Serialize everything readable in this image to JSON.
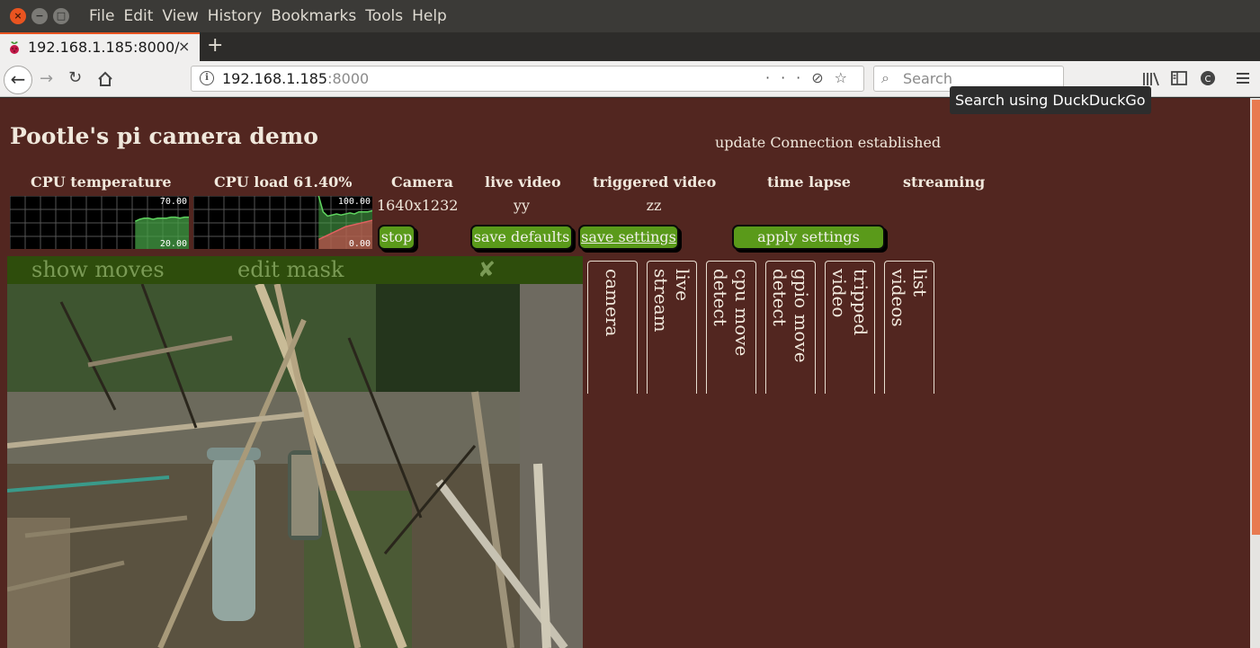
{
  "menubar": {
    "items": [
      "File",
      "Edit",
      "View",
      "History",
      "Bookmarks",
      "Tools",
      "Help"
    ]
  },
  "tab": {
    "title": "192.168.1.185:8000/",
    "close": "×",
    "new_tab": "+"
  },
  "urlbar": {
    "host": "192.168.1.185",
    "port": ":8000",
    "right_icons": "···⊘☆"
  },
  "search": {
    "placeholder": "Search",
    "tooltip": "Search using DuckDuckGo"
  },
  "page": {
    "title": "Pootle's pi camera demo",
    "status": "update Connection established",
    "headers": {
      "cpu_temp": "CPU temperature",
      "cpu_load": "CPU load 61.40%",
      "camera": "Camera",
      "live_video": "live video",
      "triggered_video": "triggered video",
      "time_lapse": "time lapse",
      "streaming": "streaming"
    },
    "values": {
      "camera_res": "1640x1232",
      "live_video": "yy",
      "triggered_video": "zz"
    },
    "gauges": {
      "temp": {
        "max": "70.00",
        "min": "20.00",
        "series": [
          0.02,
          0.02,
          0.02,
          0.02,
          0.02,
          0.02,
          0.02,
          0.02,
          0.02,
          0.02,
          0.02,
          0.02,
          0.02,
          0.02,
          0.02,
          0.02,
          0.02,
          0.02,
          0.02,
          0.02,
          0.02,
          0.02,
          0.02,
          0.02,
          0.02,
          0.02,
          0.02,
          0.02,
          0.52,
          0.56,
          0.58,
          0.58,
          0.56,
          0.58,
          0.58,
          0.58,
          0.6,
          0.6,
          0.58,
          0.6,
          0.6
        ]
      },
      "load": {
        "max": "100.00",
        "min": "0.00",
        "series": [
          0.02,
          0.02,
          0.02,
          0.02,
          0.02,
          0.02,
          0.02,
          0.02,
          0.02,
          0.02,
          0.02,
          0.02,
          0.02,
          0.02,
          0.02,
          0.02,
          0.02,
          0.02,
          0.02,
          0.02,
          0.02,
          0.02,
          0.02,
          0.02,
          0.02,
          0.02,
          0.02,
          0.02,
          1.0,
          0.7,
          0.62,
          0.64,
          0.66,
          0.64,
          0.66,
          0.68,
          0.66,
          0.7,
          0.7,
          0.7,
          0.72
        ],
        "series2": [
          0.02,
          0.02,
          0.02,
          0.02,
          0.02,
          0.02,
          0.02,
          0.02,
          0.02,
          0.02,
          0.02,
          0.02,
          0.02,
          0.02,
          0.02,
          0.02,
          0.02,
          0.02,
          0.02,
          0.02,
          0.02,
          0.02,
          0.02,
          0.02,
          0.02,
          0.02,
          0.02,
          0.02,
          0.18,
          0.22,
          0.26,
          0.3,
          0.34,
          0.38,
          0.42,
          0.44,
          0.46,
          0.48,
          0.5,
          0.52,
          0.54
        ]
      }
    },
    "buttons": {
      "stop": "stop",
      "save_defaults": "save defaults",
      "save_settings": "save settings",
      "apply_settings": "apply settings"
    },
    "toolbar": {
      "show_moves": "show moves",
      "edit_mask": "edit mask",
      "close": "✘"
    },
    "side_tabs": [
      "camera",
      "live\nstream",
      "cpu move\ndetect",
      "gpio move\ndetect",
      "tripped\nvideo",
      "list\nvideos"
    ]
  },
  "colors": {
    "page_bg": "#522620",
    "button_green": "#5a9a1a",
    "toolbar_green": "#2e4d0c",
    "accent": "#e95420"
  }
}
